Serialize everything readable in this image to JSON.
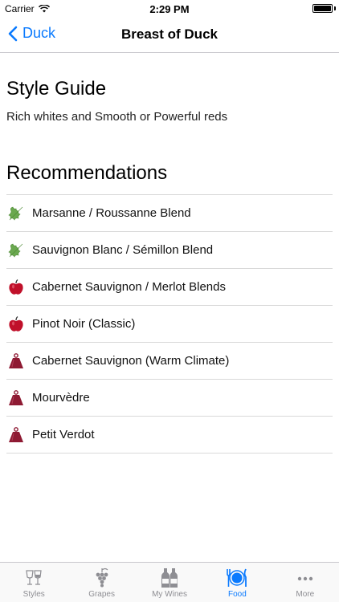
{
  "status_bar": {
    "carrier": "Carrier",
    "time": "2:29 PM"
  },
  "nav": {
    "back_label": "Duck",
    "title": "Breast of Duck"
  },
  "style_guide": {
    "title": "Style Guide",
    "description": "Rich whites and Smooth or Powerful reds"
  },
  "recommendations": {
    "title": "Recommendations",
    "items": [
      {
        "label": "Marsanne / Roussanne Blend",
        "icon": "leaf-icon"
      },
      {
        "label": "Sauvignon Blanc / Sémillon Blend",
        "icon": "leaf-icon"
      },
      {
        "label": "Cabernet Sauvignon / Merlot Blends",
        "icon": "apple-icon"
      },
      {
        "label": "Pinot Noir (Classic)",
        "icon": "apple-icon"
      },
      {
        "label": "Cabernet Sauvignon (Warm Climate)",
        "icon": "weight-icon"
      },
      {
        "label": "Mourvèdre",
        "icon": "weight-icon"
      },
      {
        "label": "Petit Verdot",
        "icon": "weight-icon"
      }
    ]
  },
  "tabs": [
    {
      "label": "Styles",
      "icon": "wine-glasses-icon"
    },
    {
      "label": "Grapes",
      "icon": "grapes-icon"
    },
    {
      "label": "My Wines",
      "icon": "wine-bottles-icon"
    },
    {
      "label": "Food",
      "icon": "plate-cutlery-icon",
      "active": true
    },
    {
      "label": "More",
      "icon": "more-dots-icon"
    }
  ],
  "colors": {
    "accent": "#0a7afe",
    "leaf": "#6aa84f",
    "red": "#c0102a",
    "burgundy": "#8e1a33"
  }
}
